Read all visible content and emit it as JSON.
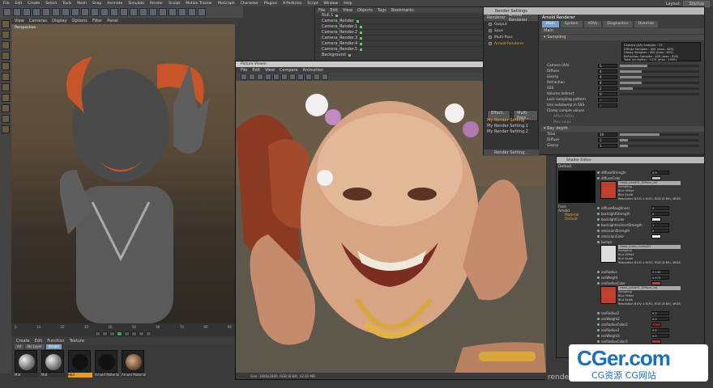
{
  "menubar": [
    "File",
    "Edit",
    "Create",
    "Select",
    "Tools",
    "Mesh",
    "Snap",
    "Animate",
    "Simulate",
    "Render",
    "Sculpt",
    "Motion Tracker",
    "MoGraph",
    "Character",
    "Plugins",
    "X-Particles",
    "Script",
    "Window",
    "Help"
  ],
  "layout": {
    "label": "Layout:",
    "value": "Startup"
  },
  "viewport": {
    "menu": [
      "View",
      "Cameras",
      "Display",
      "Options",
      "Filter",
      "Panel"
    ],
    "label": "Perspective"
  },
  "timeline": {
    "ticks": [
      "0",
      "10",
      "20",
      "30",
      "40",
      "50",
      "60",
      "70",
      "80",
      "90"
    ]
  },
  "material_manager": {
    "menu": [
      "Create",
      "Edit",
      "Function",
      "Texture"
    ],
    "tabs": [
      {
        "label": "All",
        "active": false
      },
      {
        "label": "No Layer",
        "active": false
      },
      {
        "label": "Arnold",
        "active": true
      }
    ],
    "materials": [
      {
        "label": "Mat",
        "kind": "chrome",
        "selected": false
      },
      {
        "label": "Mat",
        "kind": "chrome",
        "selected": false
      },
      {
        "label": "Hair",
        "kind": "dark",
        "selected": true
      },
      {
        "label": "Arnold Material",
        "kind": "dark",
        "selected": false
      },
      {
        "label": "Arnold Material",
        "kind": "face",
        "selected": false
      }
    ]
  },
  "object_manager": {
    "menu": [
      "File",
      "Edit",
      "View",
      "Objects",
      "Tags",
      "Bookmarks"
    ],
    "rows": [
      "Null.1",
      "Camera_Render",
      "Camera_Render.1",
      "Camera_Render.2",
      "Camera_Render.3",
      "Camera_Render.4",
      "Camera_Render.5",
      "Background"
    ]
  },
  "picture_viewer": {
    "title": "Picture Viewer",
    "menu": [
      "File",
      "Edit",
      "View",
      "Compare",
      "Animation"
    ],
    "status": "Size: 1800x1800, RGB (8 Bit), 42.81 MB"
  },
  "render_settings": {
    "title": "Render Settings",
    "sidebar_head": [
      "Renderer",
      "Arnold Renderer"
    ],
    "items": [
      {
        "label": "Output",
        "orange": false
      },
      {
        "label": "Save",
        "orange": false
      },
      {
        "label": "Multi-Pass",
        "orange": false
      },
      {
        "label": "Arnold Renderer",
        "orange": true
      }
    ],
    "buttons": [
      "Effect...",
      "Multi-Pass..."
    ],
    "settings_list": [
      {
        "label": "My Render Setting",
        "orange": true
      },
      {
        "label": "My Render Setting.1",
        "orange": false
      },
      {
        "label": "My Render Setting.2",
        "orange": false
      }
    ],
    "footer": "Render Setting...",
    "main_title": "Arnold Renderer",
    "tabs": [
      {
        "label": "Main",
        "active": true
      },
      {
        "label": "System",
        "active": false
      },
      {
        "label": "AOVs",
        "active": false
      },
      {
        "label": "Diagnostics",
        "active": false
      },
      {
        "label": "Override",
        "active": false
      }
    ],
    "section1": "Main",
    "section2": "Sampling",
    "info": [
      "Camera (AA) Samples : 25",
      "Diffuse Samples : 400 (max : 625)",
      "Glossy Samples : 400 (max : 625)",
      "Refraction Samples : 400 (max : 625)",
      "Total (no lights) : 1275 (max : 1900)"
    ],
    "params": [
      {
        "k": "Camera (AA)",
        "v": "5",
        "fill": 0.35
      },
      {
        "k": "Diffuse",
        "v": "4",
        "fill": 0.28
      },
      {
        "k": "Glossy",
        "v": "4",
        "fill": 0.28
      },
      {
        "k": "Refraction",
        "v": "4",
        "fill": 0.28
      },
      {
        "k": "SSS",
        "v": "2",
        "fill": 0.16
      },
      {
        "k": "Volume Indirect",
        "v": "0",
        "fill": 0.0
      }
    ],
    "checks": [
      "Lock sampling pattern",
      "Use autobump in SSS"
    ],
    "clamp": "Clamp sample values",
    "clamp_sub": [
      "Affect AOVs",
      "Max value"
    ],
    "section3": "Ray depth",
    "depth": [
      {
        "k": "Total",
        "v": "10",
        "fill": 0.5
      },
      {
        "k": "Diffuse",
        "v": "1",
        "fill": 0.1
      },
      {
        "k": "Glossy",
        "v": "1",
        "fill": 0.1
      }
    ]
  },
  "shader_editor": {
    "title": "Shader Editor",
    "head": "Default",
    "tree": [
      "Face",
      "Arnold",
      "Material",
      "Default"
    ],
    "rows": [
      {
        "k": "diffuseStrength",
        "v": "0.9",
        "sw": ""
      },
      {
        "k": "diffuseColor",
        "v": "",
        "sw": "#bbb"
      },
      {
        "tex": true,
        "name": "Head_paint01_Diffuse_cal",
        "thumb": "red",
        "meta": [
          "Sampling",
          "Blur Offset",
          "Blur Scale"
        ],
        "res": "Resolution 8192 x 8192, RGB (8 Bit), sRGB"
      },
      {
        "k": "diffuseRoughness",
        "v": "0",
        "sw": ""
      },
      {
        "k": "backlightStrength",
        "v": "0",
        "sw": ""
      },
      {
        "k": "backlightColor",
        "v": "",
        "sw": "#eee"
      },
      {
        "k": "backlightIndirectStrength",
        "v": "1",
        "sw": ""
      },
      {
        "k": "emissionStrength",
        "v": "0",
        "sw": ""
      },
      {
        "k": "emissionColor",
        "v": "",
        "sw": "#fff"
      },
      {
        "k": "bumps",
        "v": "",
        "sw": ""
      },
      {
        "tex": true,
        "name": "Head_bump_bump01",
        "thumb": "white",
        "meta": [
          "Sampling",
          "Blur Offset",
          "Blur Scale"
        ],
        "res": "Resolution 8192 x 8192, RGB (8 Bit), sRGB"
      },
      {
        "k": "sssRadius",
        "v": "0.133",
        "sw": ""
      },
      {
        "k": "sssWeight",
        "v": "0.475",
        "sw": ""
      },
      {
        "k": "sssRadiusColor",
        "v": "",
        "sw": "#c04030"
      },
      {
        "tex": true,
        "name": "Head_paint01_Diffuse_cal",
        "thumb": "red",
        "meta": [
          "Sampling",
          "Blur Offset",
          "Blur Scale"
        ],
        "res": "Resolution 8192 x 8192, RGB (8 Bit), sRGB"
      },
      {
        "k": "sssRadius2",
        "v": "0.2",
        "sw": ""
      },
      {
        "k": "sssWeight2",
        "v": "0.2",
        "sw": ""
      },
      {
        "k": "sssRadiusColor2",
        "v": "",
        "sw": "#8a2020"
      },
      {
        "k": "sssRadius3",
        "v": "0.5",
        "sw": ""
      },
      {
        "k": "sssWeight3",
        "v": "0.5",
        "sw": ""
      },
      {
        "k": "sssRadiusColor3",
        "v": "",
        "sw": "#c03030"
      }
    ]
  },
  "watermark": {
    "big": "CGer.com",
    "small": "CG资源 CG网站"
  },
  "render_caption": "render"
}
